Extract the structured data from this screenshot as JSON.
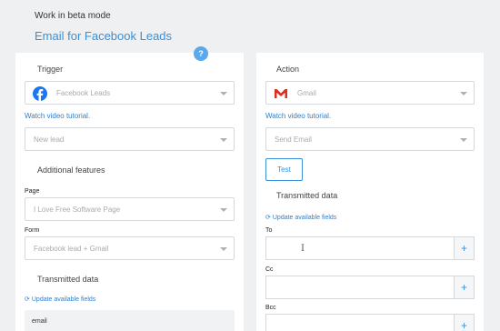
{
  "header": {
    "beta_mode": "Work in beta mode",
    "title": "Email for Facebook Leads",
    "help_badge": "?"
  },
  "trigger": {
    "heading": "Trigger",
    "app": {
      "label": "Facebook Leads",
      "icon": "facebook-icon",
      "color": "#1877f2"
    },
    "video_link": "Watch video tutorial.",
    "event": {
      "label": "New lead"
    },
    "additional_heading": "Additional features",
    "page_label": "Page",
    "page_value": "I Love Free Software Page",
    "form_label": "Form",
    "form_value": "Facebook lead + Gmail",
    "transmitted_heading": "Transmitted data",
    "update_link": "Update available fields",
    "fields": [
      "email"
    ]
  },
  "action": {
    "heading": "Action",
    "app": {
      "label": "Gmail",
      "icon": "gmail-icon",
      "color": "#d93025"
    },
    "video_link": "Watch video tutorial.",
    "event": {
      "label": "Send Email"
    },
    "test_button": "Test",
    "transmitted_heading": "Transmitted data",
    "update_link": "Update available fields",
    "to_label": "To",
    "cc_label": "Cc",
    "bcc_label": "Bcc",
    "plus": "+"
  },
  "colors": {
    "accent": "#3a8fd6",
    "panel_bg": "#ffffff",
    "page_bg": "#eef0f2"
  }
}
